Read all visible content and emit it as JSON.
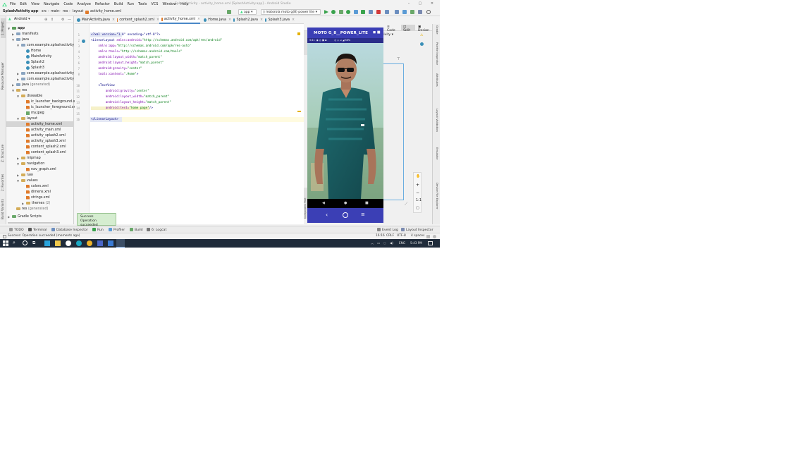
{
  "window": {
    "title": "SplashActivity - activity_home.xml [SplashActivity.app] - Android Studio",
    "min": "–",
    "max": "▢",
    "close": "✕"
  },
  "menu": [
    "File",
    "Edit",
    "View",
    "Navigate",
    "Code",
    "Analyze",
    "Refactor",
    "Build",
    "Run",
    "Tools",
    "VCS",
    "Window",
    "Help"
  ],
  "breadcrumb": [
    "SplashActivity",
    "app",
    "src",
    "main",
    "res",
    "layout",
    "activity_home.xml"
  ],
  "run_config": "app",
  "device": "motorola moto g(8) power lite",
  "project_view": "Android",
  "tree": [
    {
      "label": "app",
      "bold": true
    },
    {
      "label": "manifests"
    },
    {
      "label": "java"
    },
    {
      "label": "com.example.splashactivity"
    },
    {
      "label": "Home"
    },
    {
      "label": "MainActivity"
    },
    {
      "label": "Splash2"
    },
    {
      "label": "Splash3"
    },
    {
      "label": "com.example.splashactivity",
      "suffix": "(a"
    },
    {
      "label": "com.example.splashactivity",
      "suffix": "(te"
    },
    {
      "label": "java",
      "suffix": "(generated)"
    },
    {
      "label": "res"
    },
    {
      "label": "drawable"
    },
    {
      "label": "ic_launcher_background.xm"
    },
    {
      "label": "ic_launcher_foreground.xm"
    },
    {
      "label": "my.jpeg"
    },
    {
      "label": "layout"
    },
    {
      "label": "activity_home.xml"
    },
    {
      "label": "activity_main.xml"
    },
    {
      "label": "activity_splash2.xml"
    },
    {
      "label": "activity_splash3.xml"
    },
    {
      "label": "content_splash2.xml"
    },
    {
      "label": "content_splash3.xml"
    },
    {
      "label": "mipmap"
    },
    {
      "label": "navigation"
    },
    {
      "label": "nav_graph.xml"
    },
    {
      "label": "raw"
    },
    {
      "label": "values"
    },
    {
      "label": "colors.xml"
    },
    {
      "label": "dimens.xml"
    },
    {
      "label": "strings.xml"
    },
    {
      "label": "themes",
      "suffix": "(2)"
    },
    {
      "label": "res",
      "suffix": "(generated)"
    },
    {
      "label": "Gradle Scripts"
    }
  ],
  "tabs": [
    "MainActivity.java",
    "content_splash2.xml",
    "activity_home.xml",
    "Home.java",
    "Splash2.java",
    "Splash3.java"
  ],
  "code": {
    "lines": [
      "1",
      "2",
      "3",
      "4",
      "5",
      "6",
      "7",
      "8",
      "9",
      "10",
      "11",
      "12",
      "13",
      "14",
      "15",
      "16"
    ],
    "l1": "<?xml version=\"1.0\" encoding=\"utf-8\"?>",
    "l2a": "<LinearLayout",
    "l2b": " xmlns:android=",
    "l2c": "\"http://schemas.android.com/apk/res/android\"",
    "l3a": "    xmlns:app=",
    "l3b": "\"http://schemas.android.com/apk/res-auto\"",
    "l4a": "    xmlns:tools=",
    "l4b": "\"http://schemas.android.com/tools\"",
    "l5a": "    android:layout_width=",
    "l5b": "\"match_parent\"",
    "l6a": "    android:layout_height=",
    "l6b": "\"match_parent\"",
    "l7a": "    android:gravity=",
    "l7b": "\"center\"",
    "l8a": "    tools:context=",
    "l8b": "\".Home\"",
    "l8c": ">",
    "l10": "    <TextView",
    "l11a": "        android:gravity=",
    "l11b": "\"center\"",
    "l12a": "        android:layout_width=",
    "l12b": "\"match_parent\"",
    "l13a": "        android:layout_height=",
    "l13b": "\"match_parent\"",
    "l14a": "        android:text=",
    "l14b": "\"home page\"",
    "l14c": "/>",
    "l16": "</LinearLayout>"
  },
  "design": {
    "code": "Code",
    "split": "Split",
    "design": "Design",
    "activity": "ctivity",
    "app_title": "MOTO G_8__POWER_LITE",
    "status": "5:41  ◉ ◎ ▣ ▪          ◎ ◇ ⊿ ◢ 58%"
  },
  "right_tabs": [
    "Gradle",
    "Palette Inspector",
    "Attributes",
    "Layout Validation",
    "Emulator",
    "Device File Explorer"
  ],
  "left_tabs": [
    "1: Project",
    "Resource Manager",
    "Z: Structure",
    "2: Favorites",
    "Build Variants"
  ],
  "toast": {
    "line1": "Success",
    "line2": "Operation succeeded"
  },
  "tool_windows": [
    "TODO",
    "Terminal",
    "Database Inspector",
    "Run",
    "Profiler",
    "Build",
    "6: Logcat",
    "Event Log",
    "Layout Inspector"
  ],
  "status": {
    "message": "Success: Operation succeeded (moments ago)",
    "position": "16:16",
    "line_sep": "CRLF",
    "encoding": "UTF-8",
    "indent": "4 spaces"
  },
  "taskbar": {
    "lang": "ENG",
    "time": "5:43 PM"
  },
  "colors": {
    "accent": "#3b3fb5",
    "selection": "#4a88c7",
    "toast": "#d5edd0"
  }
}
